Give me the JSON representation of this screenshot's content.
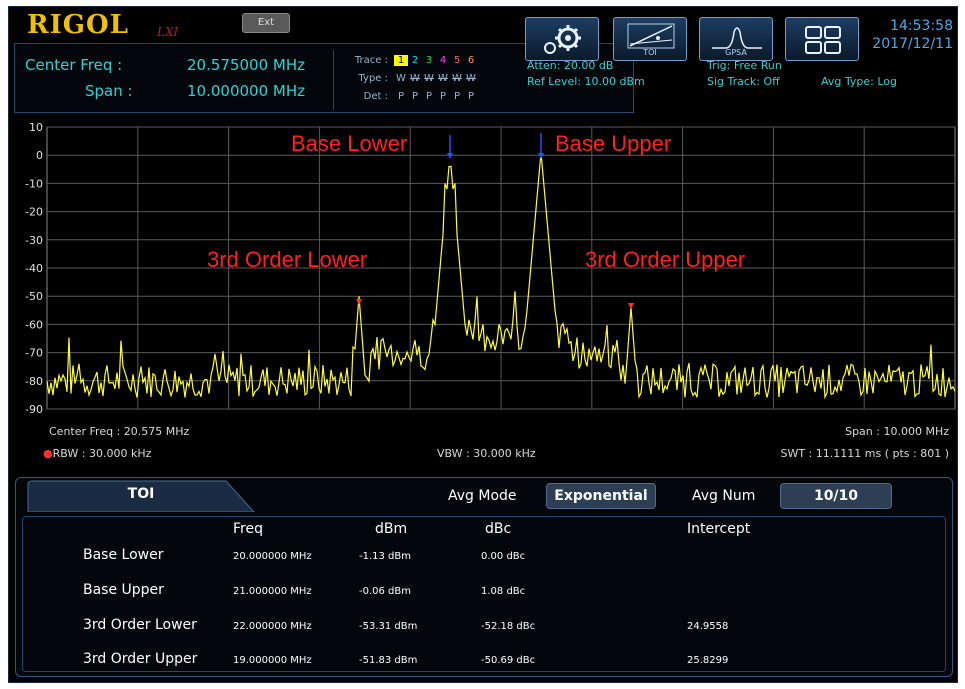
{
  "header": {
    "brand": "RIGOL",
    "brand_sub": "LXI",
    "ext_label": "Ext",
    "center_freq_label": "Center Freq :",
    "center_freq_value": "20.575000 MHz",
    "span_label": "Span :",
    "span_value": "10.000000 MHz",
    "clock_time": "14:53:58",
    "clock_date": "2017/12/11"
  },
  "trace_table": {
    "trace_label": "Trace :",
    "type_label": "Type :",
    "det_label": "Det :",
    "numbers": [
      "1",
      "2",
      "3",
      "4",
      "5",
      "6"
    ],
    "number_colors": [
      "#ffff00",
      "#00d8ff",
      "#30d030",
      "#ff40ff",
      "#ff5a5a",
      "#ff9a30"
    ],
    "types": [
      "W",
      "W",
      "W",
      "W",
      "W",
      "W"
    ],
    "dets": [
      "P",
      "P",
      "P",
      "P",
      "P",
      "P"
    ]
  },
  "measurements": {
    "atten": "Atten: 20.00 dB",
    "ref_level": "Ref Level: 10.00 dBm",
    "trig": "Trig: Free Run",
    "sig_track": "Sig Track: Off",
    "avg_type": "Avg Type: Log"
  },
  "toolbar": {
    "settings_icon": "gear-icon",
    "toi_label": "TOI",
    "gpsa_label": "GPSA",
    "layout_icon": "window-layout-icon"
  },
  "graph": {
    "y_ticks": [
      "10",
      "0",
      "-10",
      "-20",
      "-30",
      "-40",
      "-50",
      "-60",
      "-70",
      "-80",
      "-90"
    ],
    "y_min": -90,
    "y_max": 10,
    "trace_color": "#ffff30",
    "marker_labels": {
      "base_lower": "Base Lower",
      "base_upper": "Base Upper",
      "third_lower": "3rd Order Lower",
      "third_upper": "3rd Order Upper"
    },
    "footer": {
      "center_freq": "Center Freq : 20.575 MHz",
      "span": "Span : 10.000 MHz",
      "rbw": "RBW : 30.000 kHz",
      "vbw": "VBW : 30.000 kHz",
      "swt": "SWT : 11.1111 ms ( pts : 801 )"
    }
  },
  "toi": {
    "tab_label": "TOI",
    "avg_mode_label": "Avg Mode",
    "avg_mode_value": "Exponential",
    "avg_num_label": "Avg Num",
    "avg_num_value": "10/10",
    "columns": [
      "Freq",
      "dBm",
      "dBc",
      "Intercept"
    ],
    "rows": [
      {
        "label": "Base Lower",
        "freq": "20.000000 MHz",
        "dbm": "-1.13 dBm",
        "dbc": "0.00 dBc",
        "intercept": ""
      },
      {
        "label": "Base Upper",
        "freq": "21.000000 MHz",
        "dbm": "-0.06 dBm",
        "dbc": "1.08 dBc",
        "intercept": ""
      },
      {
        "label": "3rd Order Lower",
        "freq": "22.000000 MHz",
        "dbm": "-53.31 dBm",
        "dbc": "-52.18 dBc",
        "intercept": "24.9558"
      },
      {
        "label": "3rd Order Upper",
        "freq": "19.000000 MHz",
        "dbm": "-51.83 dBm",
        "dbc": "-50.69 dBc",
        "intercept": "25.8299"
      }
    ]
  }
}
